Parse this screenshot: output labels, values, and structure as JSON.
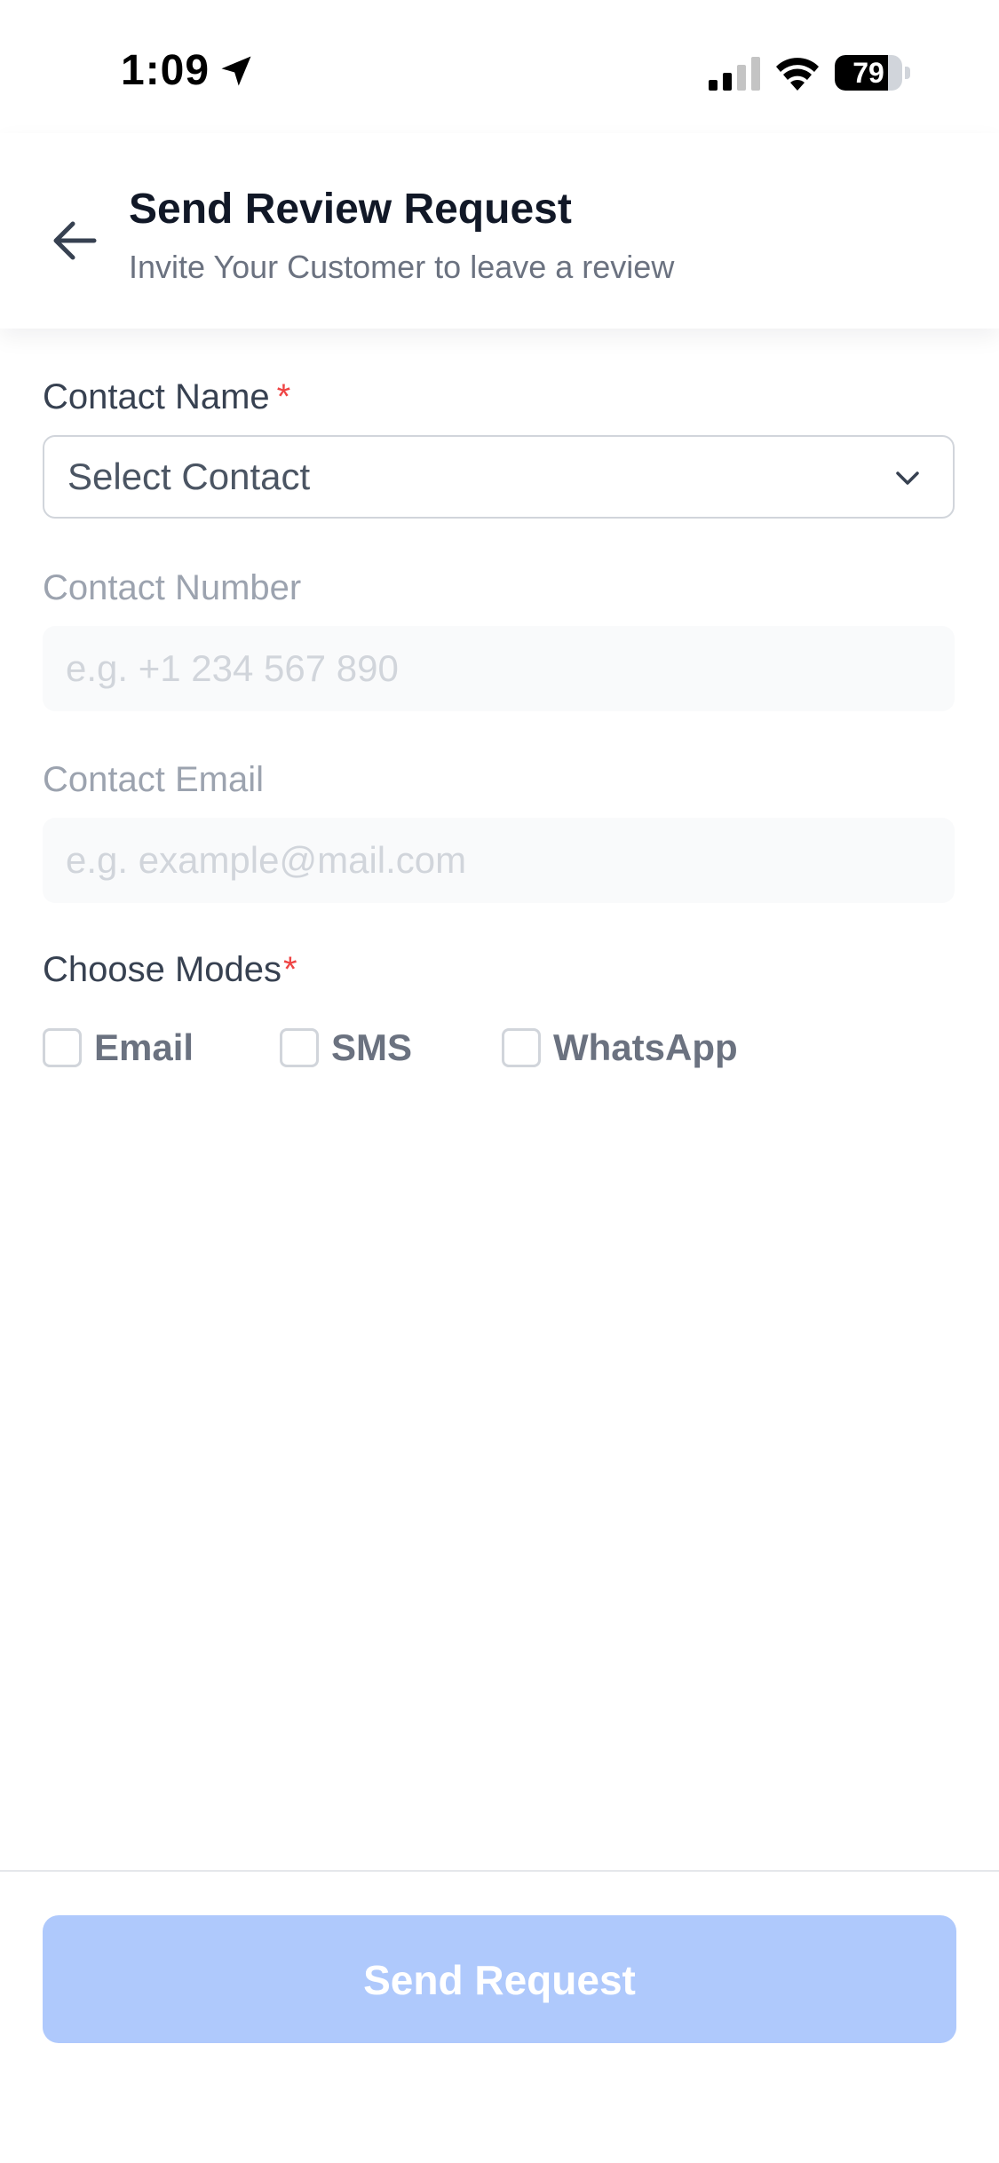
{
  "status_bar": {
    "time": "1:09",
    "battery": "79",
    "battery_level": 0.79
  },
  "header": {
    "title": "Send Review Request",
    "subtitle": "Invite Your Customer to leave a review"
  },
  "form": {
    "contact_name": {
      "label": "Contact Name",
      "required_mark": "*",
      "value": "Select Contact"
    },
    "contact_number": {
      "label": "Contact Number",
      "placeholder": "e.g. +1 234 567 890",
      "value": ""
    },
    "contact_email": {
      "label": "Contact Email",
      "placeholder": "e.g. example@mail.com",
      "value": ""
    },
    "modes": {
      "label": "Choose Modes",
      "required_mark": "*",
      "options": [
        {
          "label": "Email",
          "checked": false
        },
        {
          "label": "SMS",
          "checked": false
        },
        {
          "label": "WhatsApp",
          "checked": false
        }
      ]
    }
  },
  "footer": {
    "send_label": "Send Request"
  },
  "colors": {
    "primary_disabled": "#afc9fc",
    "required": "#ef4444"
  },
  "icons": {
    "back": "arrow-left-icon",
    "select": "chevron-down-icon",
    "location": "location-arrow-icon",
    "signal": "cellular-signal-icon",
    "wifi": "wifi-icon",
    "battery": "battery-icon"
  }
}
